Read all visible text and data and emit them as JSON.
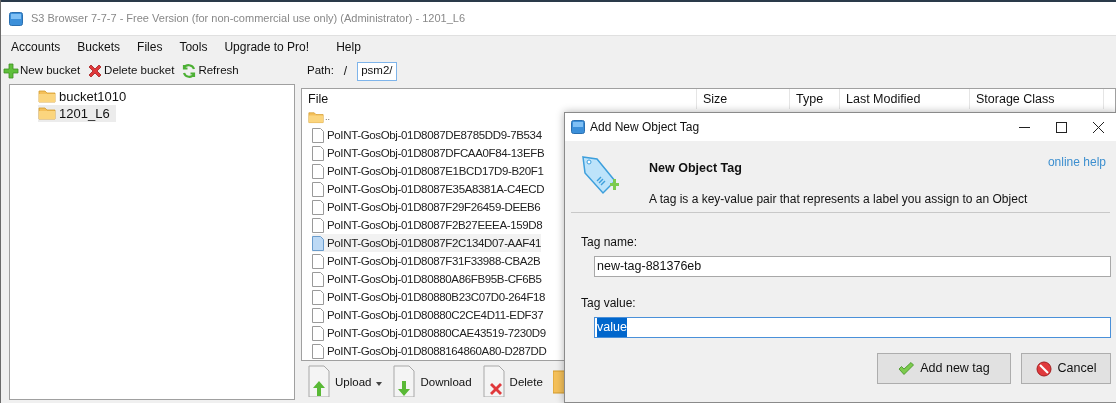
{
  "window": {
    "title": "S3 Browser 7-7-7 - Free Version (for non-commercial use only) (Administrator) - 1201_L6"
  },
  "menu": [
    "Accounts",
    "Buckets",
    "Files",
    "Tools",
    "Upgrade to Pro!",
    "Help"
  ],
  "bucket_toolbar": [
    {
      "label": "New bucket",
      "kind": "add"
    },
    {
      "label": "Delete bucket",
      "kind": "delete"
    },
    {
      "label": "Refresh",
      "kind": "refresh"
    }
  ],
  "buckets": [
    {
      "name": "bucket1010",
      "selected": false
    },
    {
      "name": "1201_L6",
      "selected": true
    }
  ],
  "path": {
    "label": "Path:",
    "root": "/",
    "value": "psm2/"
  },
  "file_table": {
    "columns": [
      "File",
      "Size",
      "Type",
      "Last Modified",
      "Storage Class"
    ],
    "parent": "..",
    "rows": [
      {
        "name": "PoINT-GosObj-01D8087DE8785DD9-7B534",
        "selected": false
      },
      {
        "name": "PoINT-GosObj-01D8087DFCAA0F84-13EFB",
        "selected": false
      },
      {
        "name": "PoINT-GosObj-01D8087E1BCD17D9-B20F1",
        "selected": false
      },
      {
        "name": "PoINT-GosObj-01D8087E35A8381A-C4ECD",
        "selected": false
      },
      {
        "name": "PoINT-GosObj-01D8087F29F26459-DEEB6",
        "selected": false
      },
      {
        "name": "PoINT-GosObj-01D8087F2B27EEEA-159D8",
        "selected": false
      },
      {
        "name": "PoINT-GosObj-01D8087F2C134D07-AAF41",
        "selected": true
      },
      {
        "name": "PoINT-GosObj-01D8087F31F33988-CBA2B",
        "selected": false
      },
      {
        "name": "PoINT-GosObj-01D80880A86FB95B-CF6B5",
        "selected": false
      },
      {
        "name": "PoINT-GosObj-01D80880B23C07D0-264F18",
        "selected": false
      },
      {
        "name": "PoINT-GosObj-01D80880C2CE4D11-EDF37",
        "selected": false
      },
      {
        "name": "PoINT-GosObj-01D80880CAE43519-7230D9",
        "selected": false
      },
      {
        "name": "PoINT-GosObj-01D8088164860A80-D287DD",
        "selected": false
      }
    ]
  },
  "file_toolbar": [
    {
      "label": "Upload",
      "kind": "upload",
      "dropdown": true
    },
    {
      "label": "Download",
      "kind": "download",
      "dropdown": false
    },
    {
      "label": "Delete",
      "kind": "delete",
      "dropdown": false
    },
    {
      "kind": "folder",
      "dropdown": false
    }
  ],
  "dialog": {
    "title": "Add New Object Tag",
    "heading": "New Object Tag",
    "description": "A tag is a key-value pair that represents a label you assign to an Object",
    "help_link": "online help",
    "fields": [
      {
        "label": "Tag name:",
        "value": "new-tag-881376eb",
        "text_selected": false,
        "focused": false
      },
      {
        "label": "Tag value:",
        "value": "value",
        "text_selected": true,
        "focused": true
      }
    ],
    "buttons": [
      {
        "label": "Add new tag",
        "kind": "ok"
      },
      {
        "label": "Cancel",
        "kind": "cancel"
      }
    ]
  }
}
